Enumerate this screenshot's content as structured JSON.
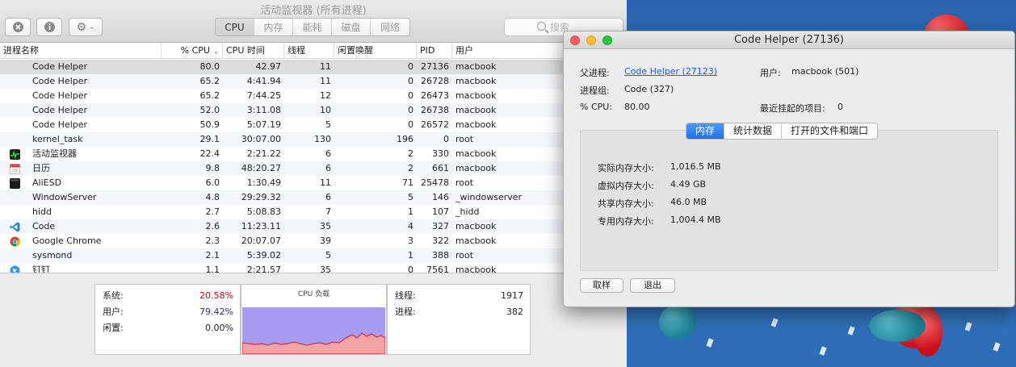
{
  "activity_monitor": {
    "title": "活动监视器 (所有进程)",
    "tabs": [
      {
        "label": "CPU",
        "active": true
      },
      {
        "label": "内存",
        "active": false
      },
      {
        "label": "能耗",
        "active": false
      },
      {
        "label": "磁盘",
        "active": false
      },
      {
        "label": "网络",
        "active": false
      }
    ],
    "search_placeholder": "搜索",
    "columns": [
      "进程名称",
      "% CPU",
      "CPU 时间",
      "线程",
      "闲置唤醒",
      "PID",
      "用户"
    ],
    "sort_indicator": "⌄",
    "rows": [
      {
        "name": "Code Helper",
        "cpu": "80.0",
        "time": "42.97",
        "threads": "11",
        "idle": "0",
        "pid": "27136",
        "user": "macbook",
        "icon": "none",
        "selected": true
      },
      {
        "name": "Code Helper",
        "cpu": "65.2",
        "time": "4:41.94",
        "threads": "11",
        "idle": "0",
        "pid": "26728",
        "user": "macbook",
        "icon": "none"
      },
      {
        "name": "Code Helper",
        "cpu": "65.2",
        "time": "7:44.25",
        "threads": "12",
        "idle": "0",
        "pid": "26473",
        "user": "macbook",
        "icon": "none"
      },
      {
        "name": "Code Helper",
        "cpu": "52.0",
        "time": "3:11.08",
        "threads": "10",
        "idle": "0",
        "pid": "26738",
        "user": "macbook",
        "icon": "none"
      },
      {
        "name": "Code Helper",
        "cpu": "50.9",
        "time": "5:07.19",
        "threads": "5",
        "idle": "0",
        "pid": "26572",
        "user": "macbook",
        "icon": "none"
      },
      {
        "name": "kernel_task",
        "cpu": "29.1",
        "time": "30:07.00",
        "threads": "130",
        "idle": "196",
        "pid": "0",
        "user": "root",
        "icon": "none"
      },
      {
        "name": "活动监视器",
        "cpu": "22.4",
        "time": "2:21.22",
        "threads": "6",
        "idle": "2",
        "pid": "330",
        "user": "macbook",
        "icon": "activity-monitor-icon"
      },
      {
        "name": "日历",
        "cpu": "9.8",
        "time": "48:20.27",
        "threads": "6",
        "idle": "2",
        "pid": "661",
        "user": "macbook",
        "icon": "calendar-icon"
      },
      {
        "name": "AliESD",
        "cpu": "6.0",
        "time": "1:30.49",
        "threads": "11",
        "idle": "71",
        "pid": "25478",
        "user": "root",
        "icon": "terminal-icon"
      },
      {
        "name": "WindowServer",
        "cpu": "4.8",
        "time": "29:29.32",
        "threads": "6",
        "idle": "5",
        "pid": "146",
        "user": "_windowserver",
        "icon": "none"
      },
      {
        "name": "hidd",
        "cpu": "2.7",
        "time": "5:08.83",
        "threads": "7",
        "idle": "1",
        "pid": "107",
        "user": "_hidd",
        "icon": "none"
      },
      {
        "name": "Code",
        "cpu": "2.6",
        "time": "11:23.11",
        "threads": "35",
        "idle": "4",
        "pid": "327",
        "user": "macbook",
        "icon": "vscode-icon"
      },
      {
        "name": "Google Chrome",
        "cpu": "2.3",
        "time": "20:07.07",
        "threads": "39",
        "idle": "3",
        "pid": "322",
        "user": "macbook",
        "icon": "chrome-icon"
      },
      {
        "name": "sysmond",
        "cpu": "2.1",
        "time": "5:39.02",
        "threads": "5",
        "idle": "1",
        "pid": "388",
        "user": "root",
        "icon": "none"
      },
      {
        "name": "钉钉",
        "cpu": "1.1",
        "time": "2:21.57",
        "threads": "35",
        "idle": "0",
        "pid": "7561",
        "user": "macbook",
        "icon": "dingtalk-icon"
      }
    ],
    "stats": {
      "system_label": "系统:",
      "system_value": "20.58%",
      "system_color": "#d0021b",
      "user_label": "用户:",
      "user_value": "79.42%",
      "user_color": "#2a2aa6",
      "idle_label": "闲置:",
      "idle_value": "0.00%",
      "graph_title": "CPU 负载",
      "threads_label": "线程:",
      "threads_value": "1917",
      "processes_label": "进程:",
      "processes_value": "382"
    }
  },
  "inspector": {
    "title": "Code Helper (27136)",
    "parent_label": "父进程:",
    "parent_value": "Code Helper (27123)",
    "user_label": "用户:",
    "user_value": "macbook (501)",
    "group_label": "进程组:",
    "group_value": "Code (327)",
    "cpu_label": "% CPU:",
    "cpu_value": "80.00",
    "recent_hang_label": "最近挂起的项目:",
    "recent_hang_value": "0",
    "tabs": [
      {
        "label": "内存",
        "active": true
      },
      {
        "label": "统计数据",
        "active": false
      },
      {
        "label": "打开的文件和端口",
        "active": false
      }
    ],
    "memory": [
      {
        "label": "实际内存大小:",
        "value": "1,016.5 MB"
      },
      {
        "label": "虚拟内存大小:",
        "value": "4.49 GB"
      },
      {
        "label": "共享内存大小:",
        "value": "46.0 MB"
      },
      {
        "label": "专用内存大小:",
        "value": "1,004.4 MB"
      }
    ],
    "sample_button": "取样",
    "quit_button": "退出"
  }
}
